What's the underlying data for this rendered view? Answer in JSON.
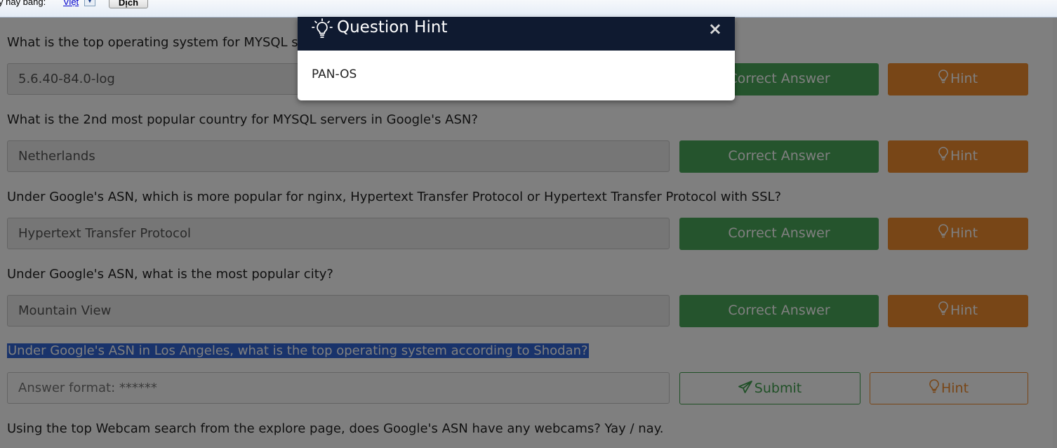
{
  "translate_bar": {
    "prompt_text": "y này bằng:",
    "language": "Việt",
    "translate_button": "Dịch"
  },
  "questions": [
    {
      "text": "What is the top operating system for MYSQL s",
      "answer": "5.6.40-84.0-log",
      "status_button": "Correct Answer",
      "hint_button": "Hint"
    },
    {
      "text": "What is the 2nd most popular country for MYSQL servers in Google's ASN?",
      "answer": "Netherlands",
      "status_button": "Correct Answer",
      "hint_button": "Hint"
    },
    {
      "text": "Under Google's ASN, which is more popular for nginx, Hypertext Transfer Protocol or Hypertext Transfer Protocol with SSL?",
      "answer": "Hypertext Transfer Protocol",
      "status_button": "Correct Answer",
      "hint_button": "Hint"
    },
    {
      "text": "Under Google's ASN, what is the most popular city?",
      "answer": "Mountain View",
      "status_button": "Correct Answer",
      "hint_button": "Hint"
    },
    {
      "text": "Under Google's ASN in Los Angeles, what is the top operating system according to Shodan?",
      "placeholder": "Answer format: ******",
      "submit_button": "Submit",
      "hint_button": "Hint"
    },
    {
      "text": "Using the top Webcam search from the explore page, does Google's ASN have any webcams? Yay / nay."
    }
  ],
  "modal": {
    "title": "Question Hint",
    "body": "PAN-OS",
    "close_glyph": "×"
  },
  "colors": {
    "correct": "#4aa85a",
    "hint": "#f08c2f",
    "modal_header": "#0f1a30",
    "selection": "#3367d6"
  }
}
